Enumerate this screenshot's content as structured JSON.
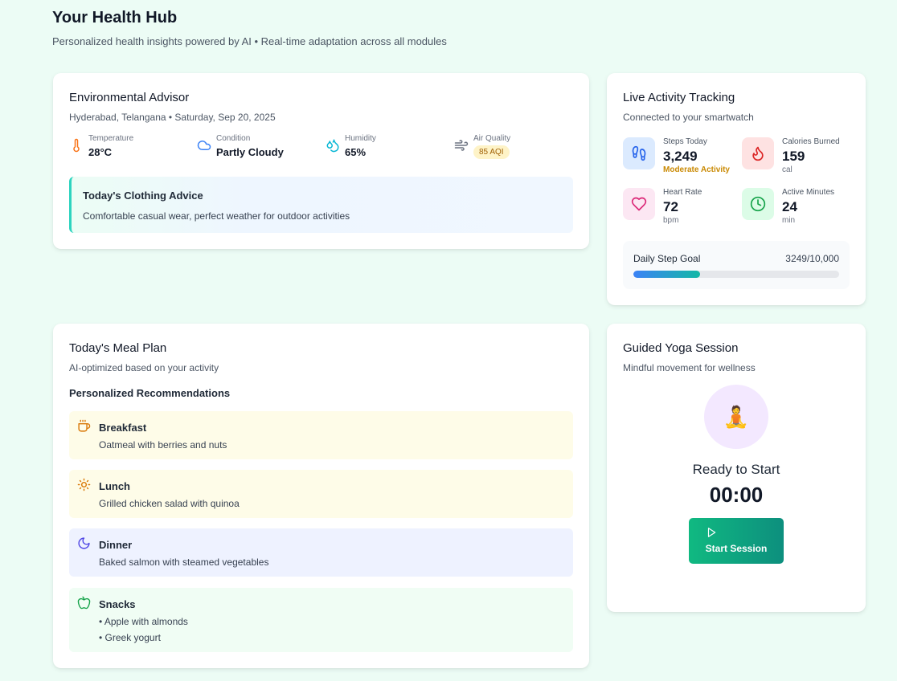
{
  "header": {
    "title": "Your Health Hub",
    "subtitle": "Personalized health insights powered by AI • Real-time adaptation across all modules"
  },
  "environment": {
    "title": "Environmental Advisor",
    "location_date": "Hyderabad, Telangana • Saturday, Sep 20, 2025",
    "temperature": {
      "label": "Temperature",
      "value": "28°C",
      "icon": "thermometer-icon"
    },
    "condition": {
      "label": "Condition",
      "value": "Partly Cloudy",
      "icon": "cloud-icon"
    },
    "humidity": {
      "label": "Humidity",
      "value": "65%",
      "icon": "droplets-icon"
    },
    "air_quality": {
      "label": "Air Quality",
      "value": "85 AQI",
      "icon": "wind-icon"
    },
    "advice": {
      "title": "Today's Clothing Advice",
      "text": "Comfortable casual wear, perfect weather for outdoor activities"
    }
  },
  "activity": {
    "title": "Live Activity Tracking",
    "subtitle": "Connected to your smartwatch",
    "steps": {
      "label": "Steps Today",
      "value": "3,249",
      "status": "Moderate Activity",
      "icon": "footprints-icon"
    },
    "calories": {
      "label": "Calories Burned",
      "value": "159",
      "unit": "cal",
      "icon": "flame-icon"
    },
    "heart_rate": {
      "label": "Heart Rate",
      "value": "72",
      "unit": "bpm",
      "icon": "heart-icon"
    },
    "active_minutes": {
      "label": "Active Minutes",
      "value": "24",
      "unit": "min",
      "icon": "clock-icon"
    },
    "goal": {
      "label": "Daily Step Goal",
      "value": "3249/10,000",
      "progress": 0.3249
    }
  },
  "meal": {
    "title": "Today's Meal Plan",
    "subtitle": "AI-optimized based on your activity",
    "section_title": "Personalized Recommendations",
    "breakfast": {
      "name": "Breakfast",
      "desc": "Oatmeal with berries and nuts",
      "icon": "coffee-icon"
    },
    "lunch": {
      "name": "Lunch",
      "desc": "Grilled chicken salad with quinoa",
      "icon": "sun-icon"
    },
    "dinner": {
      "name": "Dinner",
      "desc": "Baked salmon with steamed vegetables",
      "icon": "moon-icon"
    },
    "snacks": {
      "name": "Snacks",
      "items": [
        "• Apple with almonds",
        "• Greek yogurt"
      ],
      "icon": "apple-icon"
    }
  },
  "yoga": {
    "title": "Guided Yoga Session",
    "subtitle": "Mindful movement for wellness",
    "emoji": "🧘",
    "status": "Ready to Start",
    "timer": "00:00",
    "button_label": "Start Session"
  },
  "colors": {
    "background": "#ecfcf5",
    "accent_teal": "#14b8a6",
    "accent_green": "#10b981",
    "progress_blue": "#3b82f6",
    "aqi_badge": "#fef3c7"
  }
}
